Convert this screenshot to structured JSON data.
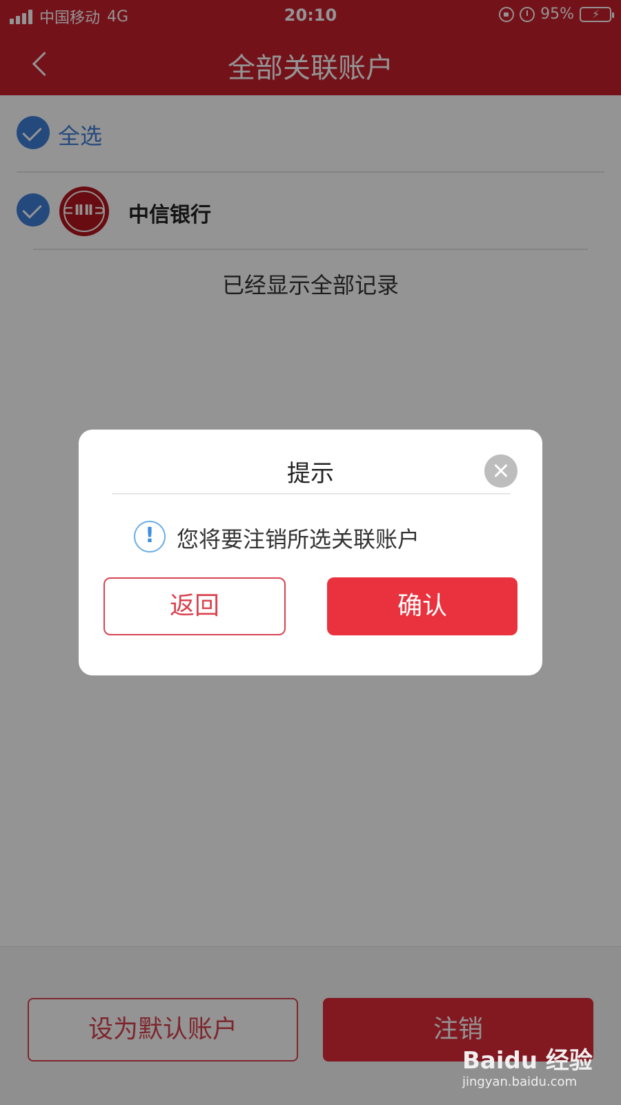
{
  "status_bar": {
    "carrier": "中国移动",
    "network": "4G",
    "time": "20:10",
    "battery": "95%"
  },
  "header": {
    "title": "全部关联账户"
  },
  "list": {
    "select_all_label": "全选",
    "bank_name": "中信银行",
    "end_text": "已经显示全部记录"
  },
  "bottom_bar": {
    "set_default_label": "设为默认账户",
    "cancel_account_label": "注销"
  },
  "dialog": {
    "title": "提示",
    "message": "您将要注销所选关联账户",
    "back_label": "返回",
    "confirm_label": "确认"
  },
  "watermark": {
    "brand": "Baidu 经验",
    "url": "jingyan.baidu.com"
  },
  "colors": {
    "header_red": "#c8202e",
    "primary_red": "#e9323d",
    "check_blue": "#3f7fd8"
  }
}
